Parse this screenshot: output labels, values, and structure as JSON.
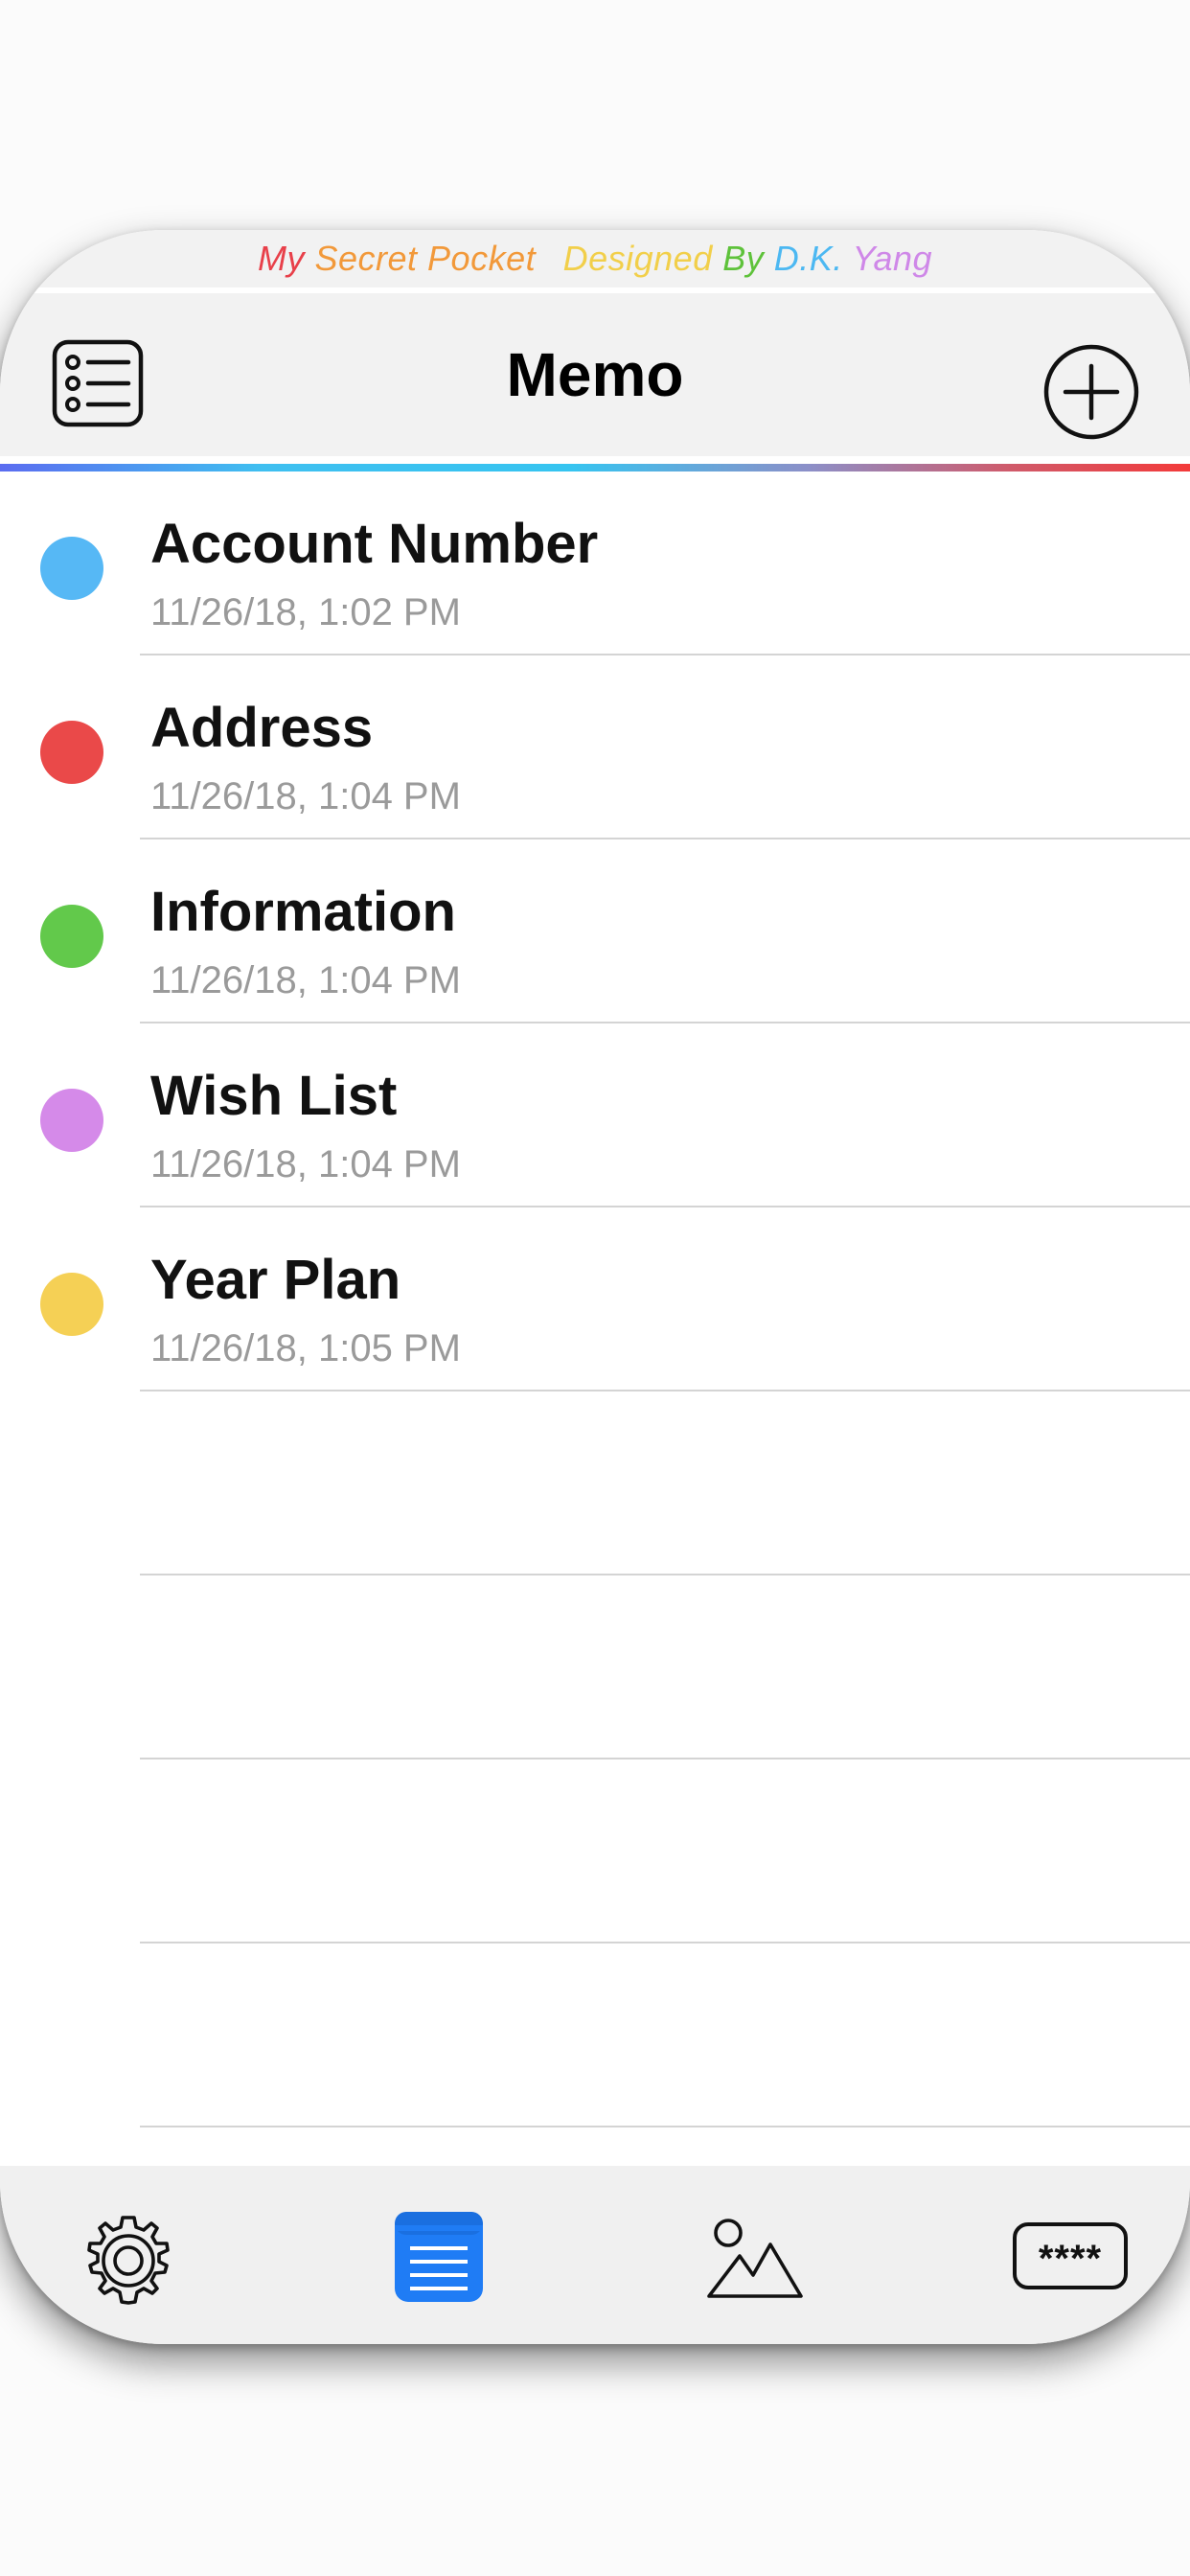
{
  "banner": {
    "words": [
      {
        "text": "My",
        "color": "#e8404a"
      },
      {
        "text": "Secret",
        "color": "#f2993a"
      },
      {
        "text": "Pocket",
        "color": "#f2993a"
      },
      {
        "text": "Designed",
        "color": "#f2cf4a"
      },
      {
        "text": "By",
        "color": "#5ec23a"
      },
      {
        "text": "D.K.",
        "color": "#4cb8f2"
      },
      {
        "text": "Yang",
        "color": "#cf88e8"
      }
    ]
  },
  "header": {
    "title": "Memo",
    "left_icon": "list-icon",
    "right_icon": "plus-circle-icon"
  },
  "memos": [
    {
      "title": "Account Number",
      "date": "11/26/18, 1:02 PM",
      "color": "#56b8f5"
    },
    {
      "title": "Address",
      "date": "11/26/18, 1:04 PM",
      "color": "#ea4949"
    },
    {
      "title": "Information",
      "date": "11/26/18, 1:04 PM",
      "color": "#62c94b"
    },
    {
      "title": "Wish List",
      "date": "11/26/18, 1:04 PM",
      "color": "#d58ae9"
    },
    {
      "title": "Year Plan",
      "date": "11/26/18, 1:05 PM",
      "color": "#f5d055"
    }
  ],
  "empty_rows": 4,
  "tabbar": {
    "tabs": [
      {
        "name": "settings",
        "icon": "gear-icon",
        "active": false
      },
      {
        "name": "memo",
        "icon": "memo-icon",
        "active": true
      },
      {
        "name": "photos",
        "icon": "photo-icon",
        "active": false
      },
      {
        "name": "passwords",
        "icon": "password-icon",
        "active": false
      }
    ],
    "password_glyph": "****",
    "accent_color": "#1f7cf5"
  }
}
